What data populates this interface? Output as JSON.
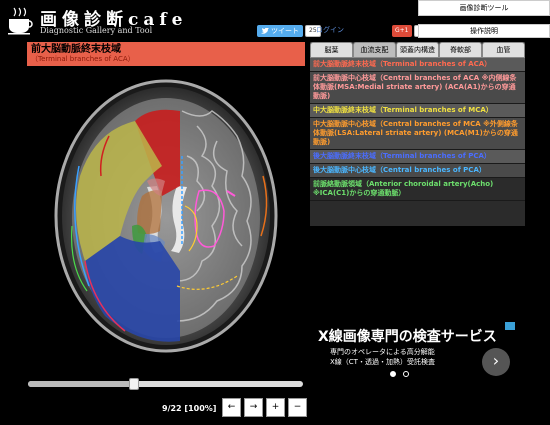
{
  "header": {
    "title": "画像診断cafe",
    "subtitle": "Diagnostic Gallery and Tool",
    "tweet_label": "ツイート",
    "tweet_count": "25",
    "login_label": "ログイン",
    "gplus_label": "G+1",
    "gplus_count": "11",
    "tool_button": "画像診断ツール",
    "manual_button": "操作説明"
  },
  "image_panel": {
    "title": "前大脳動脈終末枝域",
    "subtitle": "（Terminal branches of ACA）"
  },
  "tabs": [
    {
      "label": "脳葉"
    },
    {
      "label": "血流支配"
    },
    {
      "label": "頭蓋内構造"
    },
    {
      "label": "脊軟部"
    },
    {
      "label": "血管"
    }
  ],
  "regions": [
    {
      "label": "前大脳動脈終末枝域（Terminal branches of ACA）"
    },
    {
      "label": "前大脳動脈中心枝域（Central branches of ACA ※内側線条体動脈(MSA:Medial striate artery) (ACA(A1)からの穿通動脈)"
    },
    {
      "label": "中大脳動脈終末枝域（Terminal branches of MCA）"
    },
    {
      "label": "中大脳動脈中心枝域（Central branches of MCA ※外側線条体動脈(LSA:Lateral striate artery) (MCA(M1)からの穿通動脈)"
    },
    {
      "label": "後大脳動脈終末枝域（Terminal branches of PCA）"
    },
    {
      "label": "後大脳動脈中心枝域（Central branches of PCA）"
    },
    {
      "label": "前脈絡動脈領域（Anterior choroidal artery(Acho) ※ICA(C1)からの穿通動脈）"
    }
  ],
  "slider": {
    "value": 9,
    "max": 22
  },
  "page_info": "9/22 [100%]",
  "controls": {
    "prev": "←",
    "next": "→",
    "zoom_in": "+",
    "zoom_out": "−"
  },
  "ad": {
    "title": "X線画像専門の検査サービス",
    "line1": "専門のオペレータによる高分解能",
    "line2": "X線（CT・透過・加熱）受託検査",
    "arrow": "›"
  },
  "colors": {
    "header_bg": "#000000",
    "image_header": "#e8604a",
    "aca_terminal": "#d42020",
    "mca_terminal": "#d4cc4a",
    "pca_terminal": "#2848a8"
  }
}
